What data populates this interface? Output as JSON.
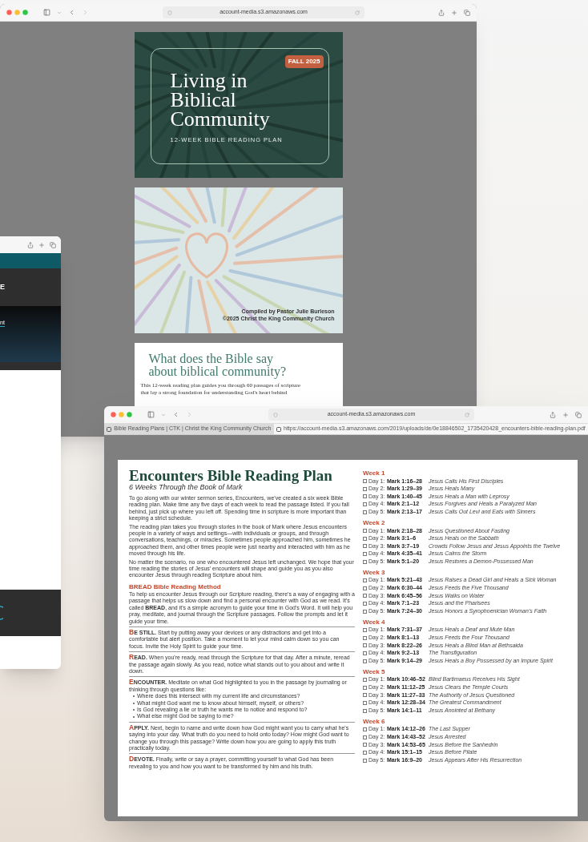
{
  "left_window": {
    "header_text": "E",
    "nav_link": "nt"
  },
  "top_window": {
    "address": "account-media.s3.amazonaws.com",
    "cover": {
      "badge": "FALL 2025",
      "title_lines": [
        "Living in",
        "Biblical",
        "Community"
      ],
      "subtitle": "12-WEEK BIBLE READING PLAN"
    },
    "credits": [
      "Compiled by Pastor Julie Burleson",
      "©2025 Christ the King Community Church"
    ],
    "intro": {
      "heading_lines": [
        "What does the Bible say",
        "about biblical community?"
      ],
      "text_lines": [
        "This 12-week reading plan guides you through 60 passages of scripture",
        "that lay a strong foundation for understanding God's heart behind"
      ]
    }
  },
  "bottom_window": {
    "address": "account-media.s3.amazonaws.com",
    "tabs": [
      {
        "label": "Bible Reading Plans | CTK | Christ the King Community Church",
        "selected": false
      },
      {
        "label": "https://account-media.s3.amazonaws.com/2019/uploads/de/0e18846502_1735420428_encounters-bible-reading-plan.pdf",
        "selected": true
      }
    ],
    "document": {
      "title": "Encounters Bible Reading Plan",
      "subtitle": "6 Weeks Through the Book of Mark",
      "paragraphs": [
        "To go along with our winter sermon series, Encounters, we've created a six week Bible reading plan. Make time any five days of each week to read the passage listed. If you fall behind, just pick up where you left off. Spending time in scripture is more important than keeping a strict schedule.",
        "The reading plan takes you through stories in the book of Mark where Jesus encounters people in a variety of ways and settings—with individuals or groups, and through conversations, teachings, or miracles. Sometimes people approached him, sometimes he approached them, and other times people were just nearby and interacted with him as he moved through his life.",
        "No matter the scenario, no one who encountered Jesus left unchanged. We hope that your time reading the stories of Jesus' encounters will shape and guide you as you also encounter Jesus through reading Scripture about him."
      ],
      "method_heading": "BREAD Bible Reading Method",
      "method_intro": "To help us encounter Jesus through our Scripture reading, there's a way of engaging with a passage that helps us slow down and find a personal encounter with God as we read. It's called **BREAD**, and it's a simple acronym to guide your time in God's Word. It will help you pray, meditate, and journal through the Scripture passages. Follow the prompts and let it guide your time.",
      "steps": [
        {
          "lead": "BE STILL.",
          "text": "Start by putting away your devices or any distractions and get into a comfortable but alert position. Take a moment to let your mind calm down so you can focus. Invite the Holy Spirit to guide your time."
        },
        {
          "lead": "READ.",
          "text": "When you're ready, read through the Scripture for that day. After a minute, reread the passage again slowly. As you read, notice what stands out to you about and write it down."
        },
        {
          "lead": "ENCOUNTER.",
          "text": "Meditate on what God highlighted to you in the passage by journaling or thinking through questions like:",
          "questions": [
            "Where does this intersect with my current life and circumstances?",
            "What might God want me to know about himself, myself, or others?",
            "Is God revealing a lie or truth he wants me to notice and respond to?",
            "What else might God be saying to me?"
          ]
        },
        {
          "lead": "APPLY.",
          "text": "Next, begin to name and write down how God might want you to carry what he's saying into your day. What truth do you need to hold onto today? How might God want to change you through this passage? Write down how you are going to apply this truth practically today."
        },
        {
          "lead": "DEVOTE.",
          "text": "Finally, write or say a prayer, committing yourself to what God has been revealing to you and how you want to be transformed by him and his truth."
        }
      ],
      "weeks": [
        {
          "title": "Week 1",
          "days": [
            {
              "day": "Day 1:",
              "passage": "Mark 1:16–28",
              "event": "Jesus Calls His First Disciples",
              "checked": false
            },
            {
              "day": "Day 2:",
              "passage": "Mark 1:29–39",
              "event": "Jesus Heals Many",
              "checked": false
            },
            {
              "day": "Day 3:",
              "passage": "Mark 1:40–45",
              "event": "Jesus Heals a Man with Leprosy",
              "checked": false
            },
            {
              "day": "Day 4:",
              "passage": "Mark 2:1–12",
              "event": "Jesus Forgives and Heals a Paralyzed Man",
              "checked": false
            },
            {
              "day": "Day 5:",
              "passage": "Mark 2:13–17",
              "event": "Jesus Calls Out Levi and Eats with Sinners",
              "checked": false
            }
          ]
        },
        {
          "title": "Week 2",
          "days": [
            {
              "day": "Day 1:",
              "passage": "Mark 2:18–28",
              "event": "Jesus Questioned About Fasting",
              "checked": false
            },
            {
              "day": "Day 2:",
              "passage": "Mark 3:1–6",
              "event": "Jesus Heals on the Sabbath",
              "checked": false
            },
            {
              "day": "Day 3:",
              "passage": "Mark 3:7–19",
              "event": "Crowds Follow Jesus and Jesus Appoints the Twelve",
              "checked": false
            },
            {
              "day": "Day 4:",
              "passage": "Mark 4:35–41",
              "event": "Jesus Calms the Storm",
              "checked": false
            },
            {
              "day": "Day 5:",
              "passage": "Mark 5:1–20",
              "event": "Jesus Restores a Demon-Possessed Man",
              "checked": false
            }
          ]
        },
        {
          "title": "Week 3",
          "days": [
            {
              "day": "Day 1:",
              "passage": "Mark 5:21–43",
              "event": "Jesus Raises a Dead Girl and Heals a Sick Woman",
              "checked": false
            },
            {
              "day": "Day 2:",
              "passage": "Mark 6:30–44",
              "event": "Jesus Feeds the Five Thousand",
              "checked": false
            },
            {
              "day": "Day 3:",
              "passage": "Mark 6:45–56",
              "event": "Jesus Walks on Water",
              "checked": false
            },
            {
              "day": "Day 4:",
              "passage": "Mark 7:1–23",
              "event": "Jesus and the Pharisees",
              "checked": false
            },
            {
              "day": "Day 5:",
              "passage": "Mark 7:24–30",
              "event": "Jesus Honors a Syrophoenician Woman's Faith",
              "checked": false
            }
          ]
        },
        {
          "title": "Week 4",
          "days": [
            {
              "day": "Day 1:",
              "passage": "Mark 7:31–37",
              "event": "Jesus Heals a Deaf and Mute Man",
              "checked": false
            },
            {
              "day": "Day 2:",
              "passage": "Mark 8:1–13",
              "event": "Jesus Feeds the Four Thousand",
              "checked": false
            },
            {
              "day": "Day 3:",
              "passage": "Mark 8:22–26",
              "event": "Jesus Heals a Blind Man at Bethsaida",
              "checked": false
            },
            {
              "day": "Day 4:",
              "passage": "Mark 9:2–13",
              "event": "The Transfiguration",
              "checked": false
            },
            {
              "day": "Day 5:",
              "passage": "Mark 9:14–29",
              "event": "Jesus Heals a Boy Possessed by an Impure Spirit",
              "checked": false
            }
          ]
        },
        {
          "title": "Week 5",
          "days": [
            {
              "day": "Day 1:",
              "passage": "Mark 10:46–52",
              "event": "Blind Bartimaeus Receives His Sight",
              "checked": false
            },
            {
              "day": "Day 2:",
              "passage": "Mark 11:12–25",
              "event": "Jesus Clears the Temple Courts",
              "checked": false
            },
            {
              "day": "Day 3:",
              "passage": "Mark 11:27–33",
              "event": "The Authority of Jesus Questioned",
              "checked": false
            },
            {
              "day": "Day 4:",
              "passage": "Mark 12:28–34",
              "event": "The Greatest Commandment",
              "checked": false
            },
            {
              "day": "Day 5:",
              "passage": "Mark 14:1–11",
              "event": "Jesus Anointed at Bethany",
              "checked": false
            }
          ]
        },
        {
          "title": "Week 6",
          "days": [
            {
              "day": "Day 1:",
              "passage": "Mark 14:12–26",
              "event": "The Last Supper",
              "checked": false
            },
            {
              "day": "Day 2:",
              "passage": "Mark 14:43–52",
              "event": "Jesus Arrested",
              "checked": false
            },
            {
              "day": "Day 3:",
              "passage": "Mark 14:53–65",
              "event": "Jesus Before the Sanhedrin",
              "checked": false
            },
            {
              "day": "Day 4:",
              "passage": "Mark 15:1–15",
              "event": "Jesus Before Pilate",
              "checked": false
            },
            {
              "day": "Day 5:",
              "passage": "Mark 16:9–20",
              "event": "Jesus Appears After His Resurrection",
              "checked": false
            }
          ]
        }
      ]
    }
  }
}
